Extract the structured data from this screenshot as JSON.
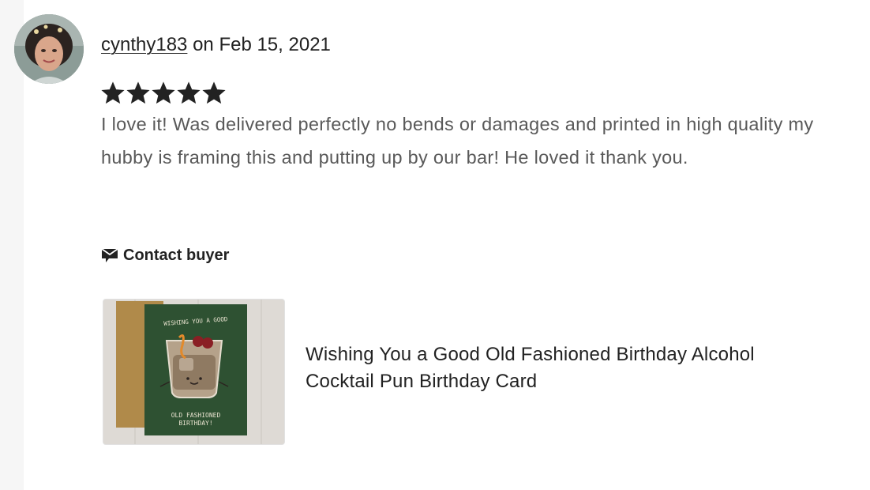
{
  "review": {
    "username": "cynthy183",
    "date_prefix": " on ",
    "date": "Feb 15, 2021",
    "rating": 5,
    "rating_max": 5,
    "text": "I love it! Was delivered perfectly no bends or damages and printed in high quality my hubby is framing this and putting up by our bar! He loved it thank you.",
    "contact_label": "Contact buyer",
    "contact_icon": "message-icon",
    "star_icon": "star-icon",
    "star_color": "#222222"
  },
  "product": {
    "title": "Wishing You a Good Old Fashioned Birthday Alcohol Cocktail Pun Birthday Card",
    "card_top_text": "WISHING YOU A GOOD",
    "card_bottom_line1": "OLD FASHIONED",
    "card_bottom_line2": "BIRTHDAY!",
    "card_color": "#2e5132",
    "envelope_color": "#b08a4a"
  }
}
